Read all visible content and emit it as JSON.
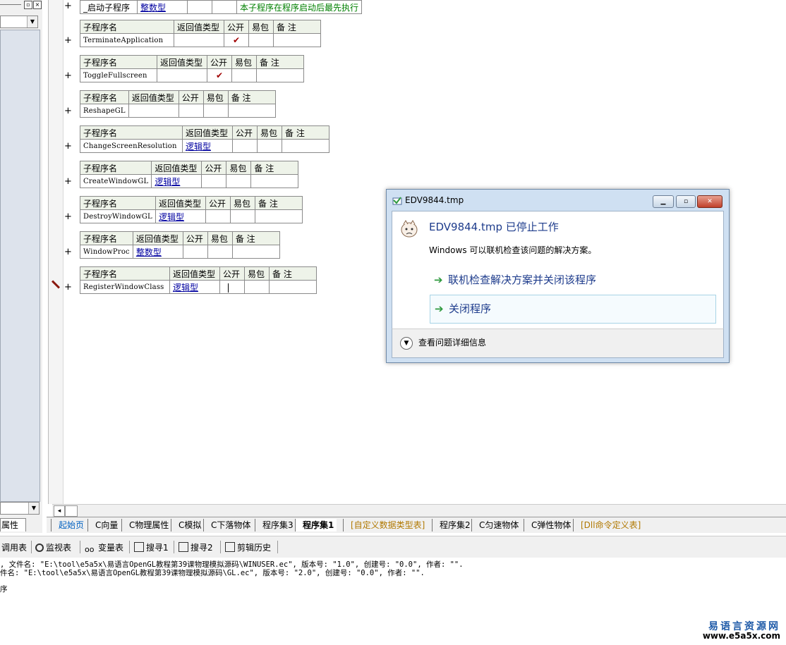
{
  "left_panel": {
    "tab_label": "属性"
  },
  "editor": {
    "top_row": {
      "name": "_启动子程序",
      "type": "整数型",
      "note": "本子程序在程序启动后最先执行"
    },
    "headers": {
      "name": "子程序名",
      "ret": "返回值类型",
      "pub": "公开",
      "easy": "易包",
      "note": "备 注"
    },
    "check_mark": "✔",
    "subs": [
      {
        "name": "TerminateApplication",
        "type": "",
        "public": true
      },
      {
        "name": "ToggleFullscreen",
        "type": "",
        "public": true
      },
      {
        "name": "ReshapeGL",
        "type": "",
        "public": false
      },
      {
        "name": "ChangeScreenResolution",
        "type": "逻辑型",
        "public": false
      },
      {
        "name": "CreateWindowGL",
        "type": "逻辑型",
        "public": false
      },
      {
        "name": "DestroyWindowGL",
        "type": "逻辑型",
        "public": false
      },
      {
        "name": "WindowProc",
        "type": "整数型",
        "public": false
      },
      {
        "name": "RegisterWindowClass",
        "type": "逻辑型",
        "public": false
      }
    ],
    "plus": "+"
  },
  "tabs": [
    "起始页",
    "C向量",
    "C物理属性",
    "C模拟",
    "C下落物体",
    "程序集3",
    "程序集1",
    "[自定义数据类型表]",
    "程序集2",
    "C匀速物体",
    "C弹性物体",
    "[Dll命令定义表]"
  ],
  "toolbar": {
    "call_table": "调用表",
    "watch": "监视表",
    "vars": "变量表",
    "search1": "搜寻1",
    "search2": "搜寻2",
    "clip_history": "剪辑历史"
  },
  "output": {
    "line1": ", 文件名: \"E:\\tool\\e5a5x\\易语言OpenGL教程第39课物理模拟源码\\WINUSER.ec\", 版本号: \"1.0\", 创建号: \"0.0\", 作者: \"\".",
    "line2": "件名: \"E:\\tool\\e5a5x\\易语言OpenGL教程第39课物理模拟源码\\GL.ec\", 版本号: \"2.0\", 创建号: \"0.0\", 作者: \"\".",
    "line3": "序"
  },
  "watermark": {
    "cn": "易语言资源网",
    "url": "www.e5a5x.com"
  },
  "dialog": {
    "title": "EDV9844.tmp",
    "heading": "EDV9844.tmp 已停止工作",
    "subtitle": "Windows 可以联机检查该问题的解决方案。",
    "option1": "联机检查解决方案并关闭该程序",
    "option2": "关闭程序",
    "details": "查看问题详细信息"
  }
}
